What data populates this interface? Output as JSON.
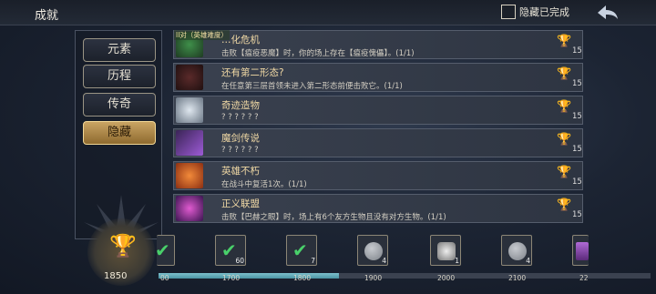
{
  "header": {
    "title": "成就",
    "hide_completed_label": "隐藏已完成",
    "hide_completed_checked": false
  },
  "categories": [
    {
      "label": "元素",
      "active": false
    },
    {
      "label": "历程",
      "active": false
    },
    {
      "label": "传奇",
      "active": false
    },
    {
      "label": "隐藏",
      "active": true
    }
  ],
  "achievements": [
    {
      "banner": "II对（英雄难度）",
      "name": "…化危机",
      "desc": "击败【瘟疫恶魔】时，你的场上存在【瘟疫傀儡】。(1/1)",
      "trophy": "gold",
      "points": "15"
    },
    {
      "name": "还有第二形态?",
      "desc": "在任意第三层首领未进入第二形态前便击败它。(1/1)",
      "trophy": "gold",
      "points": "15"
    },
    {
      "name": "奇迹造物",
      "desc": "? ? ? ? ? ?",
      "trophy": "silver",
      "points": "15"
    },
    {
      "name": "魔剑传说",
      "desc": "? ? ? ? ? ?",
      "trophy": "silver",
      "points": "15"
    },
    {
      "name": "英雄不朽",
      "desc": "在战斗中复活1次。(1/1)",
      "trophy": "gold",
      "points": "15"
    },
    {
      "name": "正义联盟",
      "desc": "击败【巴赫之眼】时，场上有6个友方生物且没有对方生物。(1/1)",
      "trophy": "gold",
      "points": "15"
    }
  ],
  "score": {
    "value": "1850"
  },
  "milestones": [
    {
      "label": "1700",
      "count": "60",
      "type": "check"
    },
    {
      "label": "1800",
      "count": "7",
      "type": "check"
    },
    {
      "label": "1900",
      "count": "4",
      "type": "stone"
    },
    {
      "label": "2000",
      "count": "1",
      "type": "gear"
    },
    {
      "label": "2100",
      "count": "4",
      "type": "stone"
    },
    {
      "label": "22",
      "count": "",
      "type": "partial"
    }
  ],
  "track_partial_label": "00",
  "colors": {
    "gold": "#e8b742",
    "accent": "#c9a464",
    "progress": "#6fb4c2"
  }
}
